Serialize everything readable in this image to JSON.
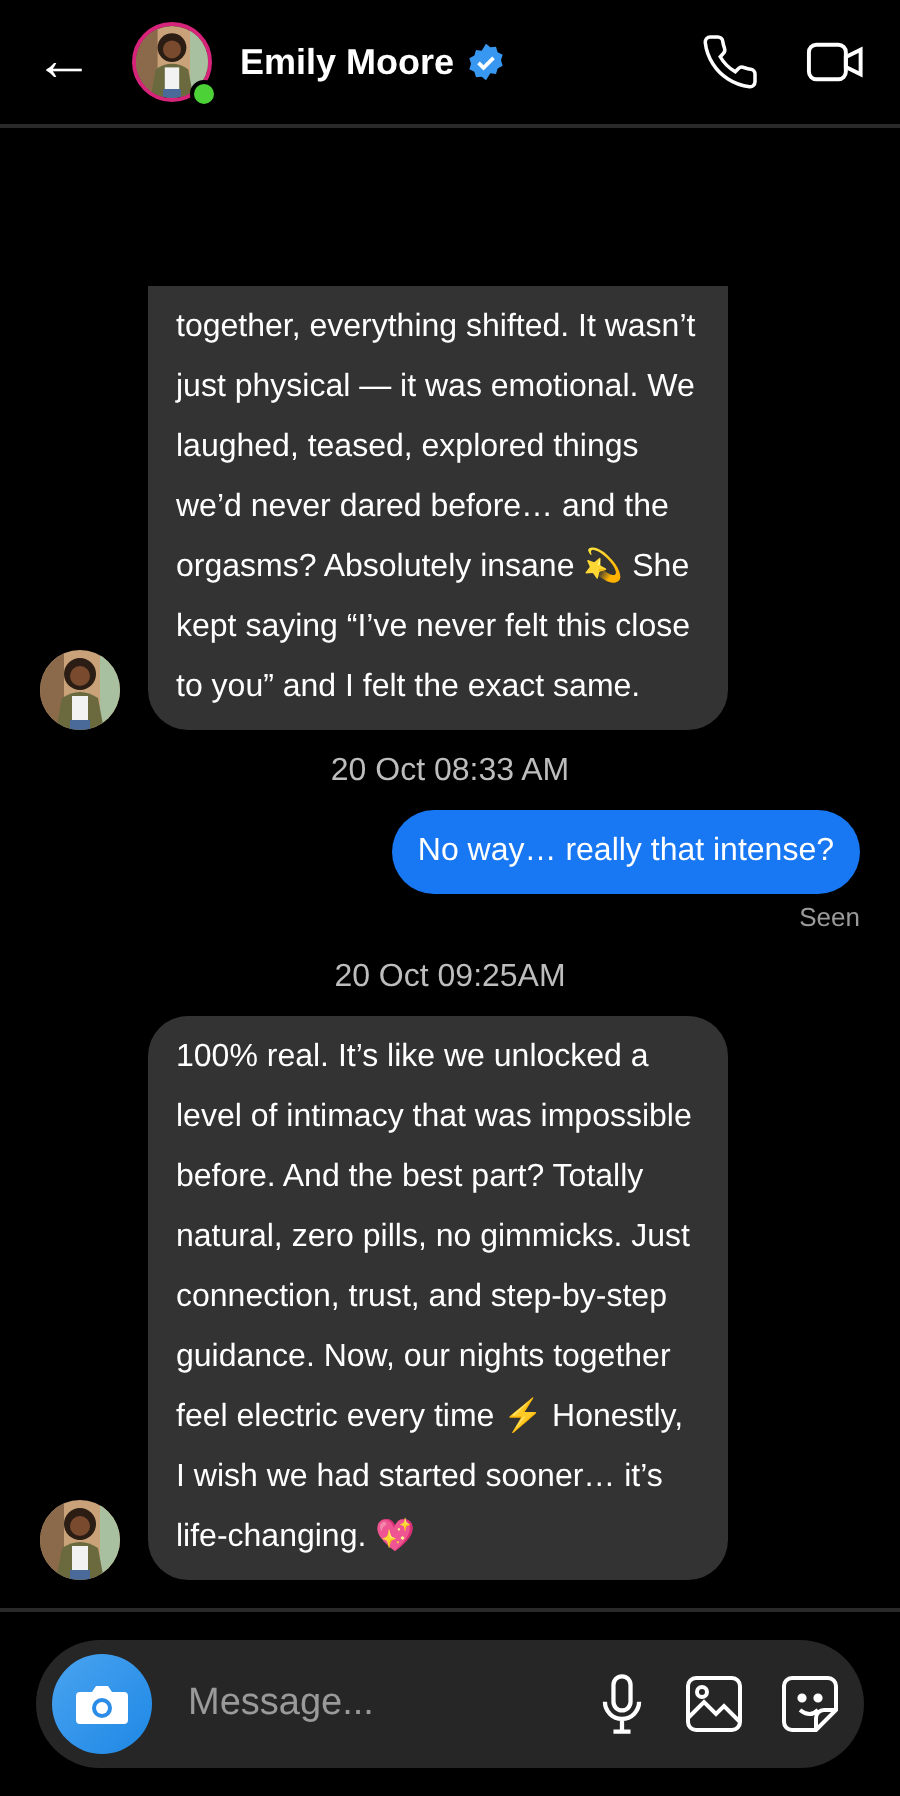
{
  "header": {
    "back": "←",
    "name": "Emily Moore",
    "verified": true,
    "online": true
  },
  "messages": [
    {
      "kind": "received",
      "text": "together, everything shifted. It wasn’t just physical — it was emotional. We laughed, teased, explored things we’d never dared before… and the orgasms? Absolutely insane 💫 She kept saying “I’ve never felt this close to you” and I felt the exact same."
    },
    {
      "kind": "timestamp",
      "text": "20 Oct 08:33 AM"
    },
    {
      "kind": "sent",
      "text": "No way… really that intense?",
      "status": "Seen"
    },
    {
      "kind": "timestamp",
      "text": "20 Oct 09:25AM"
    },
    {
      "kind": "received",
      "text": "100% real. It’s like we unlocked a level of intimacy that was impossible before. And the best part? Totally natural, zero pills, no gimmicks. Just connection, trust, and step-by-step guidance. Now, our nights together feel electric every time ⚡ Honestly, I wish we had started sooner… it’s life-changing. 💖"
    }
  ],
  "composer": {
    "placeholder": "Message..."
  }
}
